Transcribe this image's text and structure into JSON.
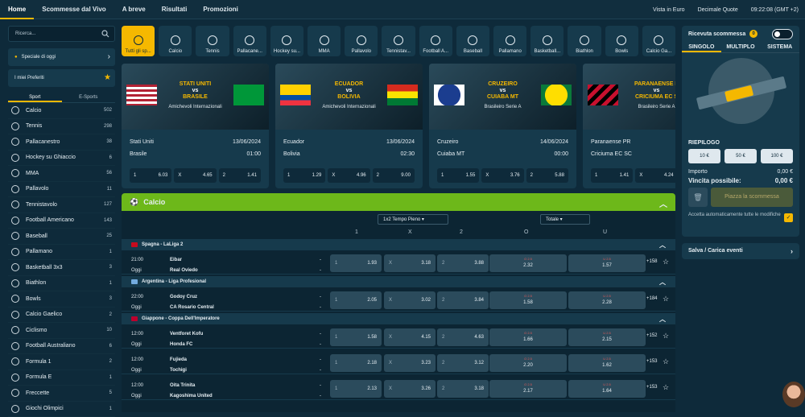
{
  "topnav": {
    "tabs": [
      "Home",
      "Scommesse dal Vivo",
      "A breve",
      "Risultati",
      "Promozioni"
    ],
    "view": "Vista in Euro",
    "odds_format": "Decimale Quote",
    "time": "09:22:08 (GMT +2)"
  },
  "left": {
    "search_placeholder": "Ricerca...",
    "special": "Speciale di oggi",
    "favorites": "I miei Preferiti",
    "tabs": [
      "Sport",
      "E-Sports"
    ],
    "sports": [
      [
        "Calcio",
        "502"
      ],
      [
        "Tennis",
        "298"
      ],
      [
        "Pallacanestro",
        "38"
      ],
      [
        "Hockey su Ghiaccio",
        "6"
      ],
      [
        "MMA",
        "56"
      ],
      [
        "Pallavolo",
        "11"
      ],
      [
        "Tennistavolo",
        "127"
      ],
      [
        "Football Americano",
        "143"
      ],
      [
        "Baseball",
        "25"
      ],
      [
        "Pallamano",
        "1"
      ],
      [
        "Basketball 3x3",
        "3"
      ],
      [
        "Biathlon",
        "1"
      ],
      [
        "Bowls",
        "3"
      ],
      [
        "Calcio Gaelico",
        "2"
      ],
      [
        "Ciclismo",
        "10"
      ],
      [
        "Football Australiano",
        "6"
      ],
      [
        "Formula 1",
        "2"
      ],
      [
        "Formula E",
        "1"
      ],
      [
        "Freccette",
        "5"
      ],
      [
        "Giochi Olimpici",
        "1"
      ]
    ]
  },
  "sportbar": [
    "Tutti gli sp...",
    "Calcio",
    "Tennis",
    "Pallacane...",
    "Hockey su...",
    "MMA",
    "Pallavolo",
    "Tennistav...",
    "Football A...",
    "Baseball",
    "Pallamano",
    "Basketball...",
    "Biathlon",
    "Bowls",
    "Calcio Ga..."
  ],
  "cards": [
    {
      "title1": "STATI UNITI",
      "title2": "BRASILE",
      "comp": "Amichevoli Internazionali",
      "home": "Stati Uniti",
      "away": "Brasile",
      "date": "13/06/2024",
      "time": "01:00",
      "o1": "6.03",
      "ox": "4.65",
      "o2": "1.41"
    },
    {
      "title1": "ECUADOR",
      "title2": "BOLIVIA",
      "comp": "Amichevoli Internazionali",
      "home": "Ecuador",
      "away": "Bolivia",
      "date": "13/06/2024",
      "time": "02:30",
      "o1": "1.29",
      "ox": "4.96",
      "o2": "9.00"
    },
    {
      "title1": "CRUZEIRO",
      "title2": "CUIABA MT",
      "comp": "Brasileiro Serie A",
      "home": "Cruzeiro",
      "away": "Cuiaba MT",
      "date": "14/06/2024",
      "time": "00:00",
      "o1": "1.55",
      "ox": "3.76",
      "o2": "5.88"
    },
    {
      "title1": "PARANAENSE P",
      "title2": "CRICIUMA EC S",
      "comp": "Brasileiro Serie A",
      "home": "Paranaense PR",
      "away": "Criciuma EC SC",
      "date": "",
      "time": "",
      "o1": "1.41",
      "ox": "4.24",
      "o2": ""
    }
  ],
  "calcio": {
    "title": "Calcio",
    "market": "1x2 Tempo Pieno",
    "market2": "Totale",
    "cols": [
      "1",
      "X",
      "2",
      "O",
      "U"
    ]
  },
  "leagues": [
    {
      "name": "Spagna - LaLiga 2",
      "matches": [
        {
          "time": "21:00",
          "day": "Oggi",
          "home": "Eibar",
          "away": "Real Oviedo",
          "o1": "1.93",
          "ox": "3.18",
          "o2": "3.88",
          "over": "2.32",
          "under": "1.57",
          "ou": "O 2.5",
          "uu": "U 2.5",
          "more": "+158"
        }
      ]
    },
    {
      "name": "Argentina - Liga Profesional",
      "matches": [
        {
          "time": "22:00",
          "day": "Oggi",
          "home": "Godoy Cruz",
          "away": "CA Rosario Central",
          "o1": "2.05",
          "ox": "3.02",
          "o2": "3.84",
          "over": "1.58",
          "under": "2.28",
          "ou": "O 2.5",
          "uu": "U 2.5",
          "more": "+184"
        }
      ]
    },
    {
      "name": "Giappone - Coppa Dell'Imperatore",
      "matches": [
        {
          "time": "12:00",
          "day": "Oggi",
          "home": "Ventforet Kofu",
          "away": "Honda FC",
          "o1": "1.58",
          "ox": "4.15",
          "o2": "4.63",
          "over": "1.66",
          "under": "2.15",
          "ou": "O 2.5",
          "uu": "U 2.5",
          "more": "+152"
        },
        {
          "time": "12:00",
          "day": "Oggi",
          "home": "Fujieda",
          "away": "Tochigi",
          "o1": "2.18",
          "ox": "3.23",
          "o2": "3.12",
          "over": "2.20",
          "under": "1.62",
          "ou": "O 2.5",
          "uu": "U 2.5",
          "more": "+153"
        },
        {
          "time": "12:00",
          "day": "Oggi",
          "home": "Oita Trinita",
          "away": "Kagoshima United",
          "o1": "2.13",
          "ox": "3.26",
          "o2": "3.18",
          "over": "2.17",
          "under": "1.64",
          "ou": "O 2.5",
          "uu": "U 2.5",
          "more": "+153"
        }
      ]
    }
  ],
  "slip": {
    "title": "Ricevuta scommessa",
    "count": "0",
    "tabs": [
      "SINGOLO",
      "MULTIPLO",
      "SISTEMA"
    ],
    "summary": "RIEPILOGO",
    "stakes": [
      "10 €",
      "50 €",
      "100 €"
    ],
    "importo_label": "Importo",
    "importo": "0,00 €",
    "vincita_label": "Vincita possibile:",
    "vincita": "0,00 €",
    "place": "Piazza la scommessa",
    "auto": "Accetta automaticamente tutte le modifiche"
  },
  "save": "Salva / Carica eventi"
}
